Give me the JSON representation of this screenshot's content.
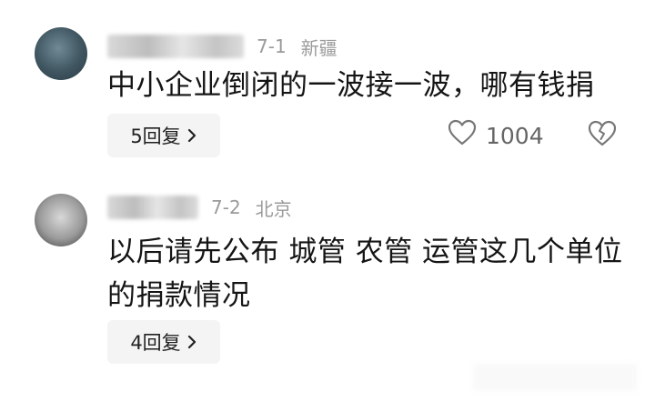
{
  "comments": [
    {
      "date": "7-1",
      "location": "新疆",
      "text": "中小企业倒闭的一波接一波，哪有钱捐",
      "reply_label": "5回复",
      "like_count": "1004"
    },
    {
      "date": "7-2",
      "location": "北京",
      "text": "以后请先公布 城管 农管 运管这几个单位的捐款情况",
      "reply_label": "4回复"
    }
  ],
  "icons": {
    "like": "heart-icon",
    "dislike": "broken-heart-icon",
    "reply_more": "chevron-right-icon"
  },
  "colors": {
    "meta_text": "#9a9a9a",
    "reply_bg": "#f4f4f4"
  }
}
